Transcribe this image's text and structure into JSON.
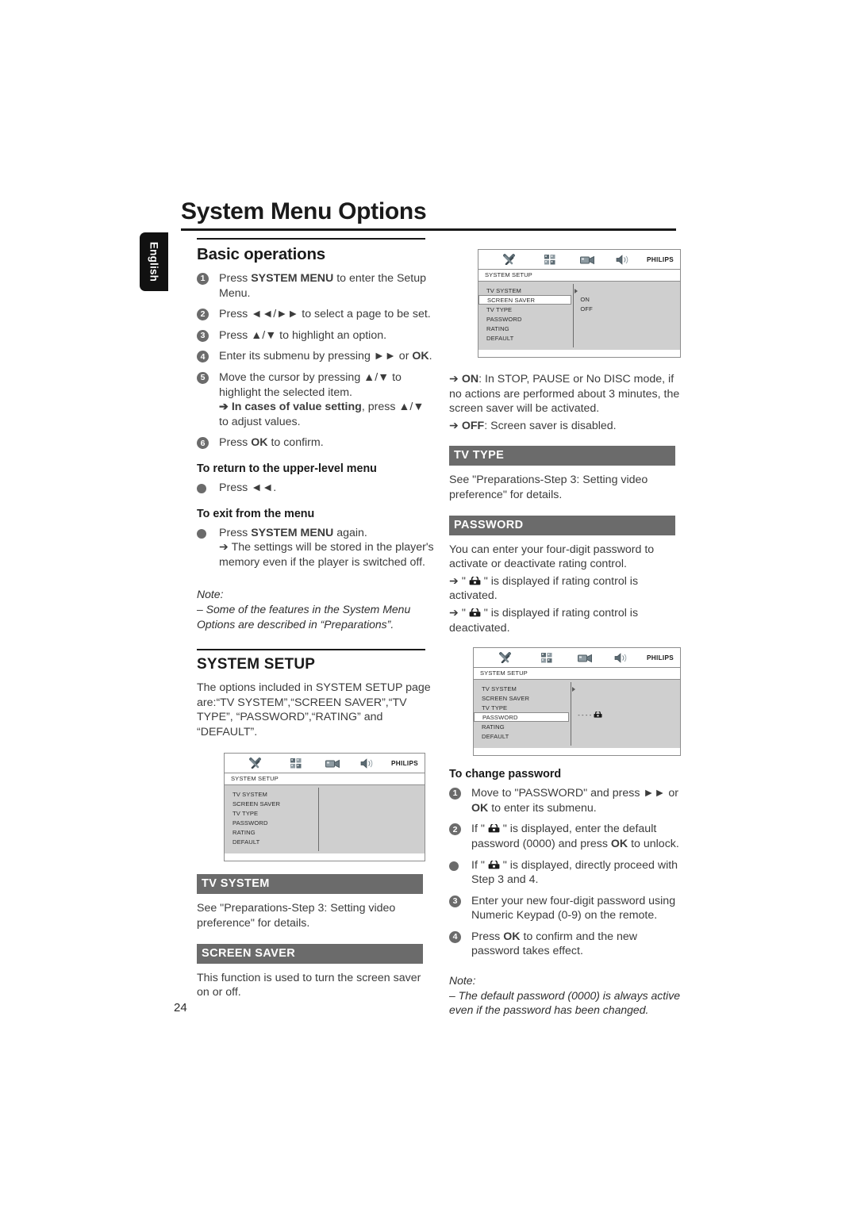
{
  "page": {
    "title": "System Menu Options",
    "language_tab": "English",
    "number": "24",
    "bar_color": "#6b6b6b",
    "accent_color": "#1a1a1a"
  },
  "left_column": {
    "basic_operations": {
      "heading": "Basic operations",
      "steps": [
        {
          "marker": "1",
          "text_html": "Press <b>SYSTEM MENU</b> to enter the Setup Menu."
        },
        {
          "marker": "2",
          "text_html": "Press ◄◄/►►  to select a page to be set."
        },
        {
          "marker": "3",
          "text_html": "Press ▲/▼  to highlight an option."
        },
        {
          "marker": "4",
          "text_html": "Enter its submenu by pressing ►►  or <b>OK</b>."
        },
        {
          "marker": "5",
          "text_html": "Move the cursor by pressing ▲/▼  to highlight the selected item.<br><b>➔ In cases of value setting</b>, press ▲/▼  to adjust values."
        },
        {
          "marker": "6",
          "text_html": "Press <b>OK</b> to confirm."
        }
      ]
    },
    "return_upper": {
      "heading": "To return to the upper-level menu",
      "bullet_html": "Press ◄◄."
    },
    "exit_menu": {
      "heading": "To exit from the menu",
      "bullet_html": "Press <b>SYSTEM MENU</b> again.<br>➔ The settings will be stored in the player's memory even if the player is switched off."
    },
    "note": {
      "label": "Note:",
      "text": "–  Some of the features in the System Menu Options are described in “Preparations”."
    },
    "system_setup": {
      "heading": "SYSTEM SETUP",
      "intro": "The options included in SYSTEM SETUP page are:“TV SYSTEM”,“SCREEN SAVER”,“TV TYPE”, “PASSWORD”,“RATING” and “DEFAULT”."
    },
    "tv_system": {
      "bar": "TV SYSTEM",
      "text": "See \"Preparations-Step 3: Setting video preference\" for details."
    },
    "screen_saver": {
      "bar": "SCREEN SAVER",
      "text": "This function is used to turn the screen saver on or off."
    }
  },
  "right_column": {
    "screen_saver_modes": {
      "on_html": "➔ <b>ON</b>: In STOP, PAUSE or No DISC mode, if no actions are performed about 3 minutes, the screen saver will be activated.",
      "off_html": "➔ <b>OFF</b>: Screen saver is disabled."
    },
    "tv_type": {
      "bar": "TV TYPE",
      "text": "See \"Preparations-Step 3: Setting video preference\" for details."
    },
    "password": {
      "bar": "PASSWORD",
      "intro": "You can enter your four-digit password to activate or deactivate rating control.",
      "activated_html": "➔ \" <span class=\"lockslot\"></span> \" is displayed if rating control is activated.",
      "deactivated_html": "➔ \" <span class=\"lockslot\"></span> \" is displayed if rating control is deactivated."
    },
    "change_password": {
      "heading": "To change password",
      "steps": [
        {
          "marker": "1",
          "text_html": "Move to \"PASSWORD\" and press ►► or <b>OK</b> to enter its submenu."
        },
        {
          "marker": "2",
          "text_html": "If \" <span class=\"lockslot\"></span> \" is displayed, enter the default password (0000) and press <b>OK</b> to unlock."
        },
        {
          "marker": "•",
          "text_html": "If \" <span class=\"lockslot\"></span> \" is displayed, directly proceed with Step 3 and 4."
        },
        {
          "marker": "3",
          "text_html": "Enter your new four-digit password using Numeric Keypad (0-9) on the remote."
        },
        {
          "marker": "4",
          "text_html": "Press <b>OK</b> to confirm and the new password takes effect."
        }
      ]
    },
    "note": {
      "label": "Note:",
      "text": "–  The default password (0000) is always active even if the password has been changed."
    }
  },
  "osd_screens": {
    "screen_saver_submenu": {
      "brand": "PHILIPS",
      "subtitle": "SYSTEM SETUP",
      "menu_items": [
        "TV SYSTEM",
        "SCREEN SAVER",
        "TV TYPE",
        "PASSWORD",
        "RATING",
        "DEFAULT"
      ],
      "selected_index": 1,
      "values": [
        "ON",
        "OFF"
      ]
    },
    "system_setup_plain": {
      "brand": "PHILIPS",
      "subtitle": "SYSTEM SETUP",
      "menu_items": [
        "TV SYSTEM",
        "SCREEN SAVER",
        "TV TYPE",
        "PASSWORD",
        "RATING",
        "DEFAULT"
      ],
      "selected_index": -1,
      "values": []
    },
    "password_submenu": {
      "brand": "PHILIPS",
      "subtitle": "SYSTEM SETUP",
      "menu_items": [
        "TV SYSTEM",
        "SCREEN SAVER",
        "TV TYPE",
        "PASSWORD",
        "RATING",
        "DEFAULT"
      ],
      "selected_index": 3,
      "values": [
        "- - - -"
      ]
    }
  }
}
